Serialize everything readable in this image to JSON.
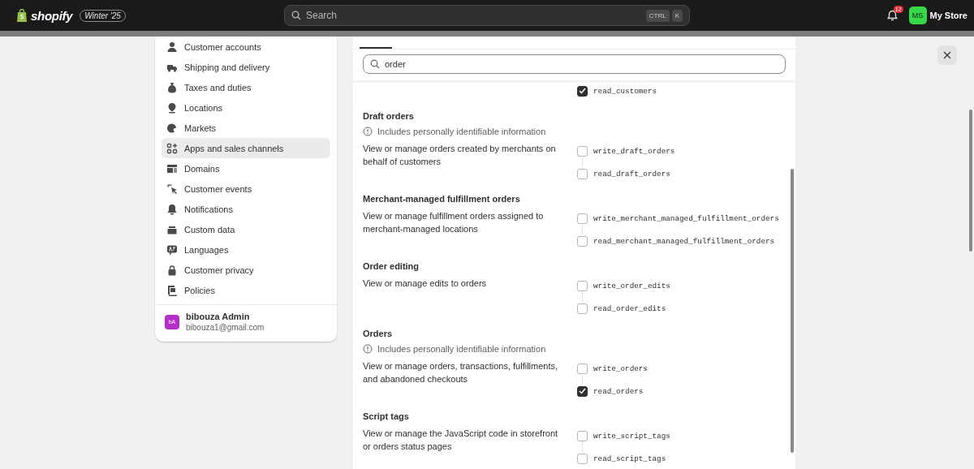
{
  "topbar": {
    "logo_text": "shopify",
    "badge": "Winter '25",
    "search_placeholder": "Search",
    "shortcut": [
      "CTRL",
      "K"
    ],
    "notifications_count": "12",
    "store_initials": "MS",
    "store_name": "My Store"
  },
  "sidebar": {
    "items": [
      {
        "label": "Customer accounts",
        "selected": false
      },
      {
        "label": "Shipping and delivery",
        "selected": false
      },
      {
        "label": "Taxes and duties",
        "selected": false
      },
      {
        "label": "Locations",
        "selected": false
      },
      {
        "label": "Markets",
        "selected": false
      },
      {
        "label": "Apps and sales channels",
        "selected": true
      },
      {
        "label": "Domains",
        "selected": false
      },
      {
        "label": "Customer events",
        "selected": false
      },
      {
        "label": "Notifications",
        "selected": false
      },
      {
        "label": "Custom data",
        "selected": false
      },
      {
        "label": "Languages",
        "selected": false
      },
      {
        "label": "Customer privacy",
        "selected": false
      },
      {
        "label": "Policies",
        "selected": false
      }
    ],
    "user": {
      "initials": "bA",
      "name": "bibouza Admin",
      "email": "bibouza1@gmail.com"
    }
  },
  "scopes_panel": {
    "search": {
      "value": "order"
    },
    "sections": [
      {
        "scopes": [
          {
            "name": "read_customers",
            "checked": true
          }
        ]
      },
      {
        "title": "Draft orders",
        "pii_note": "Includes personally identifiable information",
        "description": "View or manage orders created by merchants on behalf of customers",
        "scopes": [
          {
            "name": "write_draft_orders",
            "checked": false
          },
          {
            "name": "read_draft_orders",
            "checked": false
          }
        ]
      },
      {
        "title": "Merchant-managed fulfillment orders",
        "description": "View or manage fulfillment orders assigned to merchant-managed locations",
        "scopes": [
          {
            "name": "write_merchant_managed_fulfillment_orders",
            "checked": false
          },
          {
            "name": "read_merchant_managed_fulfillment_orders",
            "checked": false
          }
        ]
      },
      {
        "title": "Order editing",
        "description": "View or manage edits to orders",
        "scopes": [
          {
            "name": "write_order_edits",
            "checked": false
          },
          {
            "name": "read_order_edits",
            "checked": false
          }
        ]
      },
      {
        "title": "Orders",
        "pii_note": "Includes personally identifiable information",
        "description": "View or manage orders, transactions, fulfillments, and abandoned checkouts",
        "scopes": [
          {
            "name": "write_orders",
            "checked": false
          },
          {
            "name": "read_orders",
            "checked": true
          }
        ]
      },
      {
        "title": "Script tags",
        "description": "View or manage the JavaScript code in storefront or orders status pages",
        "scopes": [
          {
            "name": "write_script_tags",
            "checked": false
          },
          {
            "name": "read_script_tags",
            "checked": false
          }
        ]
      }
    ]
  }
}
